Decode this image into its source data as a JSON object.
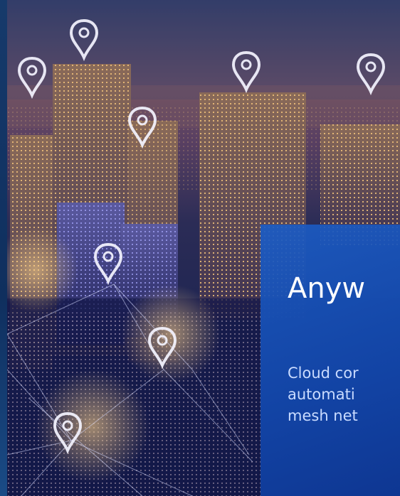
{
  "hero": {
    "image_alt": "Night city skyline with connected location pins"
  },
  "card": {
    "title": "Anyw",
    "description_lines": [
      "Cloud cor",
      "automati",
      "mesh net"
    ]
  },
  "colors": {
    "card_blue": "#1c5cc4",
    "text_white": "#ffffff",
    "desc_text": "#c9dbff"
  },
  "icons": [
    "location-pin-icon"
  ]
}
